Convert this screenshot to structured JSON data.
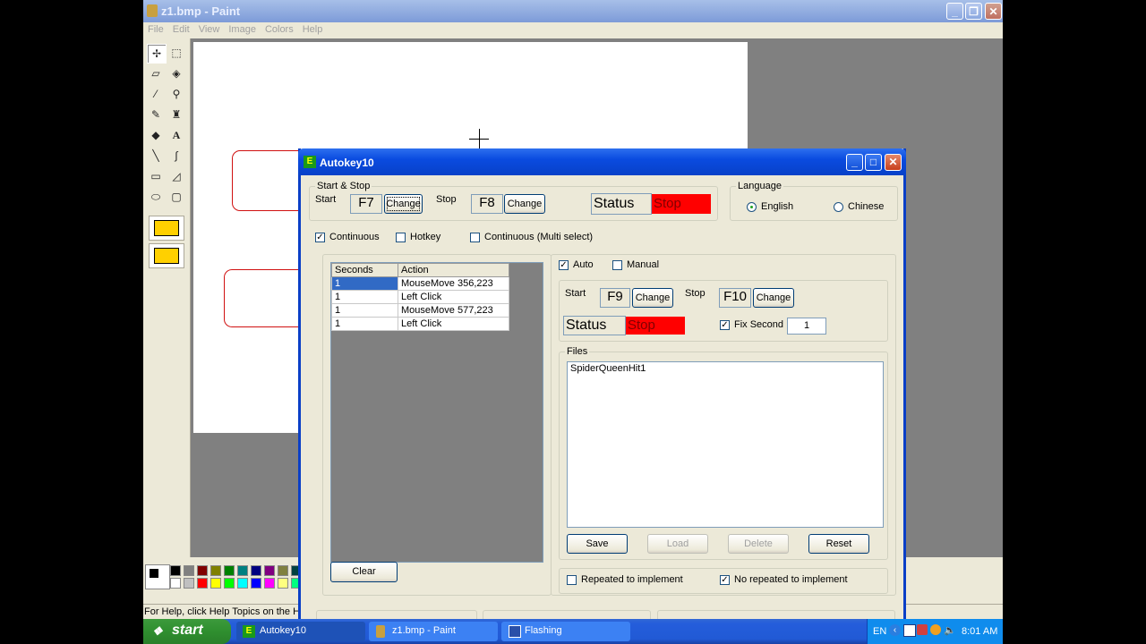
{
  "paint": {
    "title": "z1.bmp - Paint",
    "menu": [
      "File",
      "Edit",
      "View",
      "Image",
      "Colors",
      "Help"
    ],
    "status": "For Help, click Help Topics on the Help"
  },
  "autokey": {
    "title": "Autokey10",
    "start_stop": {
      "group_label": "Start & Stop",
      "start_label": "Start",
      "start_key": "F7",
      "change_label": "Change",
      "stop_label": "Stop",
      "stop_key": "F8",
      "status_label": "Status",
      "status_value": "Stop"
    },
    "language": {
      "group_label": "Language",
      "options": [
        "English",
        "Chinese"
      ],
      "selected": "English"
    },
    "modes": {
      "continuous": "Continuous",
      "hotkey": "Hotkey",
      "continuous_multi": "Continuous (Multi select)"
    },
    "grid": {
      "headers": [
        "Seconds",
        "Action"
      ],
      "rows": [
        [
          "1",
          "MouseMove 356,223"
        ],
        [
          "1",
          "Left Click"
        ],
        [
          "1",
          "MouseMove 577,223"
        ],
        [
          "1",
          "Left Click"
        ]
      ],
      "clear_label": "Clear"
    },
    "record": {
      "auto": "Auto",
      "manual": "Manual",
      "start_label": "Start",
      "start_key": "F9",
      "change_label": "Change",
      "stop_label": "Stop",
      "stop_key": "F10",
      "status_label": "Status",
      "status_value": "Stop",
      "fix_second_label": "Fix Second",
      "fix_second_value": "1"
    },
    "files": {
      "group_label": "Files",
      "items": [
        "SpiderQueenHit1"
      ],
      "save": "Save",
      "load": "Load",
      "delete": "Delete",
      "reset": "Reset"
    },
    "repeat": {
      "repeated": "Repeated to implement",
      "no_repeated": "No repeated to implement"
    }
  },
  "taskbar": {
    "start": "start",
    "tasks": [
      "Autokey10",
      "z1.bmp - Paint",
      "Flashing"
    ],
    "lang": "EN",
    "clock": "8:01 AM"
  },
  "colors": {
    "accent": "#0a4be0",
    "status_red": "#ff0000",
    "palette_top": [
      "#000000",
      "#808080",
      "#800000",
      "#808000",
      "#008000",
      "#008080",
      "#000080",
      "#800080",
      "#808040",
      "#004040",
      "#0080ff"
    ],
    "palette_bottom": [
      "#ffffff",
      "#c0c0c0",
      "#ff0000",
      "#ffff00",
      "#00ff00",
      "#00ffff",
      "#0000ff",
      "#ff00ff",
      "#ffff80",
      "#00ff80",
      "#80ffff"
    ]
  }
}
